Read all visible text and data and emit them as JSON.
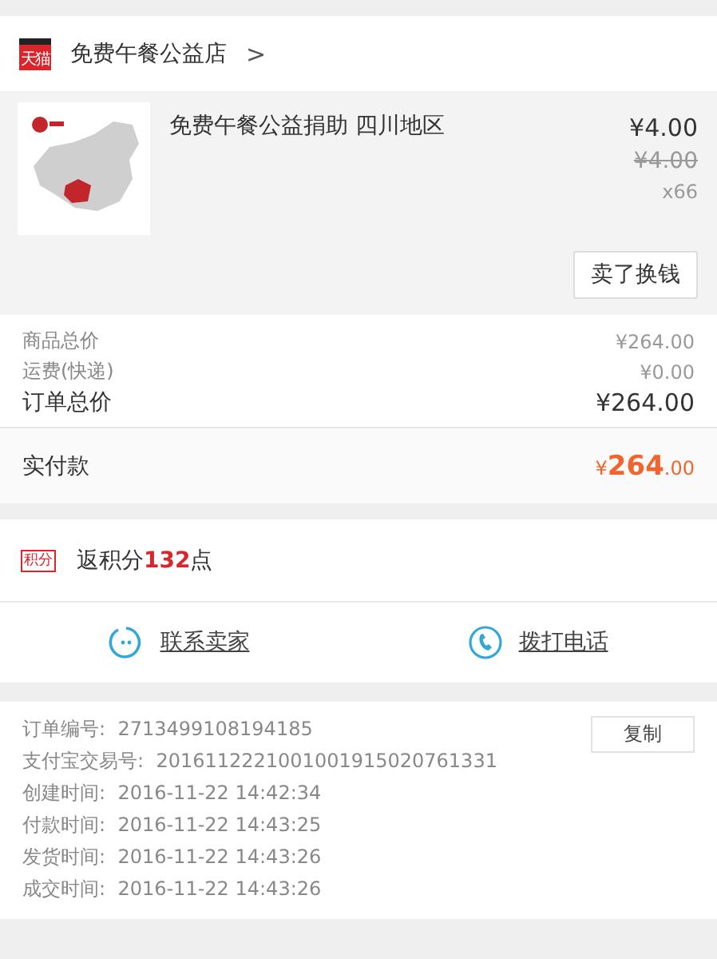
{
  "shop": {
    "logo_text": "天猫",
    "name": "免费午餐公益店",
    "chevron": ">"
  },
  "item": {
    "title": "免费午餐公益捐助 四川地区",
    "price": "¥4.00",
    "original_price": "¥4.00",
    "quantity": "x66",
    "action": "卖了换钱"
  },
  "summary": [
    {
      "label": "商品总价",
      "value": "¥264.00",
      "kind": "minor"
    },
    {
      "label": "运费(快递)",
      "value": "¥0.00",
      "kind": "minor"
    },
    {
      "label": "订单总价",
      "value": "¥264.00",
      "kind": "major"
    }
  ],
  "paid": {
    "label": "实付款",
    "currency": "¥",
    "amount": "264",
    "decimals": ".00"
  },
  "points": {
    "badge": "积分",
    "text": "返积分**132**点"
  },
  "contacts": [
    {
      "kind": "chat",
      "label": "联系卖家"
    },
    {
      "kind": "phone",
      "label": "拨打电话"
    }
  ],
  "details": {
    "copy_button": "复制",
    "rows": [
      {
        "label": "订单编号:",
        "value": "2713499108194185"
      },
      {
        "label": "支付宝交易号:",
        "value": "2016112221001001915020761331"
      },
      {
        "label": "创建时间:",
        "value": "2016-11-22 14:42:34"
      },
      {
        "label": "付款时间:",
        "value": "2016-11-22 14:43:25"
      },
      {
        "label": "发货时间:",
        "value": "2016-11-22 14:43:26"
      },
      {
        "label": "成交时间:",
        "value": "2016-11-22 14:43:26"
      }
    ]
  }
}
